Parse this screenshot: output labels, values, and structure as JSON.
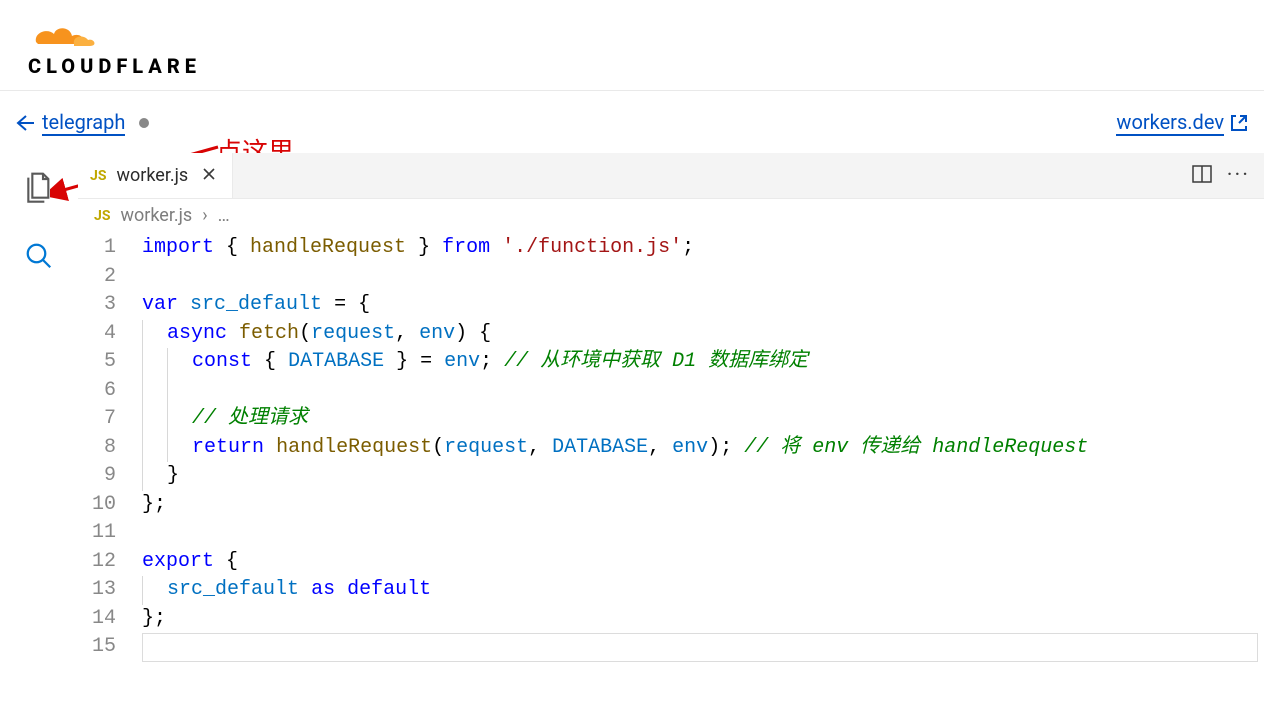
{
  "brand": "CLOUDFLARE",
  "nav": {
    "back_label": "telegraph",
    "right_link": "workers.dev"
  },
  "annotation": {
    "text": "点这里"
  },
  "sidebar_icons": {
    "files": "files-icon",
    "search": "search-icon"
  },
  "tab": {
    "filename": "worker.js",
    "lang_badge": "JS"
  },
  "breadcrumb": {
    "filename": "worker.js",
    "lang_badge": "JS",
    "sep": "›",
    "more": "…"
  },
  "code": {
    "lines": [
      {
        "n": 1,
        "segments": [
          [
            "k",
            "import"
          ],
          [
            "p",
            " { "
          ],
          [
            "fn",
            "handleRequest"
          ],
          [
            "p",
            " } "
          ],
          [
            "k",
            "from"
          ],
          [
            "p",
            " "
          ],
          [
            "s",
            "'./function.js'"
          ],
          [
            "p",
            ";"
          ]
        ]
      },
      {
        "n": 2,
        "segments": []
      },
      {
        "n": 3,
        "segments": [
          [
            "k",
            "var"
          ],
          [
            "p",
            " "
          ],
          [
            "var",
            "src_default"
          ],
          [
            "p",
            " = {"
          ]
        ]
      },
      {
        "n": 4,
        "indent": 1,
        "segments": [
          [
            "k",
            "async"
          ],
          [
            "p",
            " "
          ],
          [
            "fn",
            "fetch"
          ],
          [
            "p",
            "("
          ],
          [
            "var",
            "request"
          ],
          [
            "p",
            ", "
          ],
          [
            "var",
            "env"
          ],
          [
            "p",
            ") {"
          ]
        ]
      },
      {
        "n": 5,
        "indent": 2,
        "segments": [
          [
            "k",
            "const"
          ],
          [
            "p",
            " { "
          ],
          [
            "var",
            "DATABASE"
          ],
          [
            "p",
            " } = "
          ],
          [
            "var",
            "env"
          ],
          [
            "p",
            "; "
          ],
          [
            "c",
            "// 从环境中获取 D1 数据库绑定"
          ]
        ]
      },
      {
        "n": 6,
        "indent": 2,
        "segments": []
      },
      {
        "n": 7,
        "indent": 2,
        "segments": [
          [
            "c",
            "// 处理请求"
          ]
        ]
      },
      {
        "n": 8,
        "indent": 2,
        "segments": [
          [
            "k",
            "return"
          ],
          [
            "p",
            " "
          ],
          [
            "fn",
            "handleRequest"
          ],
          [
            "p",
            "("
          ],
          [
            "var",
            "request"
          ],
          [
            "p",
            ", "
          ],
          [
            "var",
            "DATABASE"
          ],
          [
            "p",
            ", "
          ],
          [
            "var",
            "env"
          ],
          [
            "p",
            "); "
          ],
          [
            "c",
            "// 将 env 传递给 handleRequest"
          ]
        ]
      },
      {
        "n": 9,
        "indent": 1,
        "segments": [
          [
            "p",
            "}"
          ]
        ]
      },
      {
        "n": 10,
        "segments": [
          [
            "p",
            "};"
          ]
        ]
      },
      {
        "n": 11,
        "segments": []
      },
      {
        "n": 12,
        "segments": [
          [
            "k",
            "export"
          ],
          [
            "p",
            " {"
          ]
        ]
      },
      {
        "n": 13,
        "indent": 1,
        "segments": [
          [
            "var",
            "src_default"
          ],
          [
            "p",
            " "
          ],
          [
            "k",
            "as"
          ],
          [
            "p",
            " "
          ],
          [
            "k",
            "default"
          ]
        ]
      },
      {
        "n": 14,
        "segments": [
          [
            "p",
            "};"
          ]
        ]
      },
      {
        "n": 15,
        "segments": [],
        "current": true
      }
    ]
  }
}
